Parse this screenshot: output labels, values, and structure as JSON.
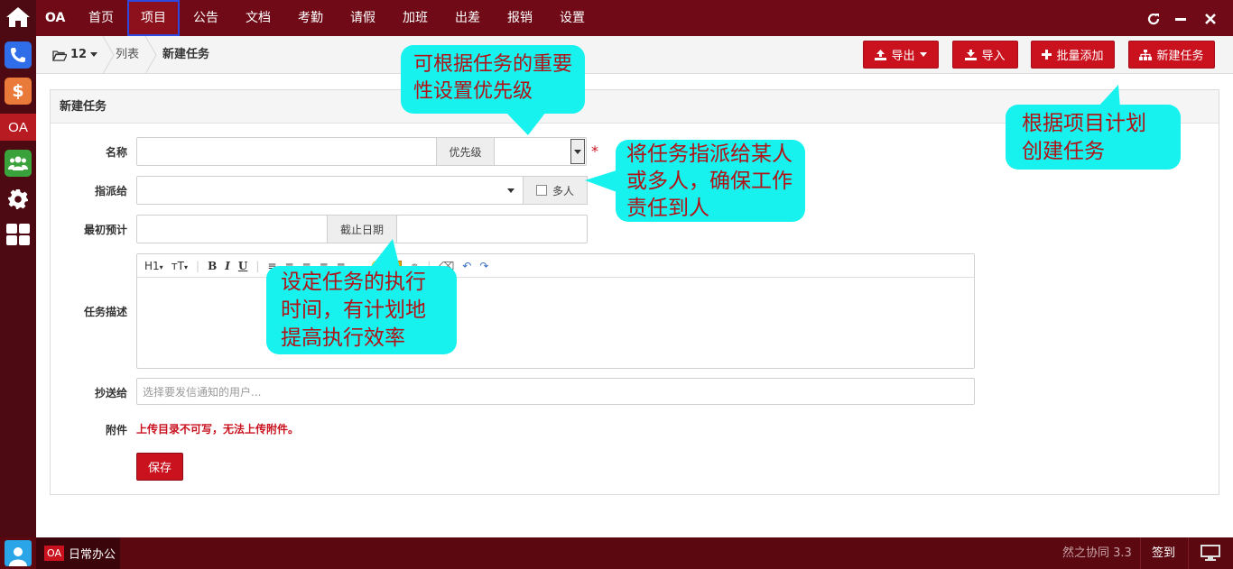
{
  "dock": {
    "oa_label": "OA",
    "dollar_label": "$"
  },
  "topbar": {
    "brand": "OA",
    "menu": [
      "首页",
      "项目",
      "公告",
      "文档",
      "考勤",
      "请假",
      "加班",
      "出差",
      "报销",
      "设置"
    ],
    "active_menu": "项目"
  },
  "breadcrumb": {
    "folder_count": "12",
    "list_label": "列表",
    "current": "新建任务"
  },
  "actions": {
    "export": "导出",
    "import": "导入",
    "batch_add": "批量添加",
    "new_task": "新建任务"
  },
  "panel": {
    "title": "新建任务"
  },
  "form": {
    "name_label": "名称",
    "priority_label": "优先级",
    "required_mark": "*",
    "assign_label": "指派给",
    "multi_label": "多人",
    "estimate_label": "最初预计",
    "deadline_label": "截止日期",
    "desc_label": "任务描述",
    "cc_label": "抄送给",
    "cc_placeholder": "选择要发信通知的用户...",
    "attachment_label": "附件",
    "attachment_error": "上传目录不可写，无法上传附件。",
    "save": "保存"
  },
  "editor": {
    "heading_btn": "H1",
    "size_btn": "тT",
    "bold": "B",
    "italic": "I",
    "underline": "U"
  },
  "callouts": {
    "priority": "可根据任务的重要性设置优先级",
    "create": "根据项目计划创建任务",
    "assign": "将任务指派给某人或多人，确保工作责任到人",
    "schedule": "设定任务的执行时间，有计划地提高执行效率"
  },
  "taskbar": {
    "app_icon": "OA",
    "app_label": "日常办公",
    "version": "然之协同 3.3",
    "signin": "签到"
  },
  "colors": {
    "topbar": "#6f0a16",
    "dock": "#4e0a12",
    "accent_red": "#c9121e",
    "callout_bg": "#18f2ef",
    "callout_text": "#b01216"
  }
}
